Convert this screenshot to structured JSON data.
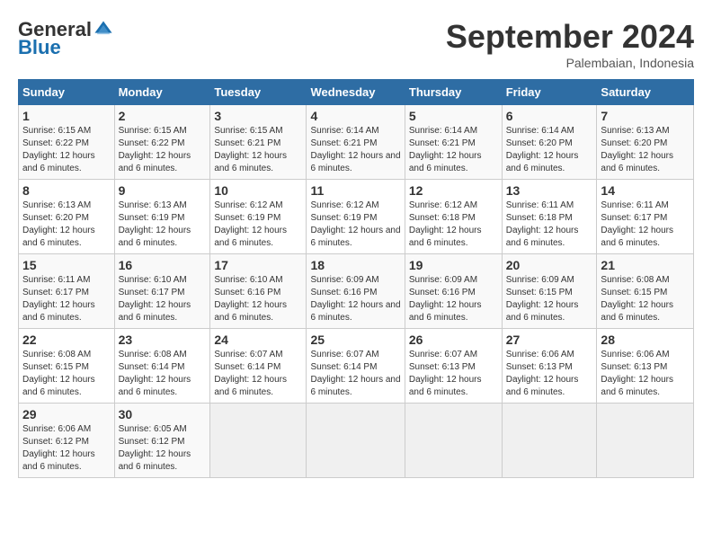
{
  "header": {
    "logo_general": "General",
    "logo_blue": "Blue",
    "month_title": "September 2024",
    "subtitle": "Palembaian, Indonesia"
  },
  "calendar": {
    "days_of_week": [
      "Sunday",
      "Monday",
      "Tuesday",
      "Wednesday",
      "Thursday",
      "Friday",
      "Saturday"
    ],
    "weeks": [
      [
        {
          "day": "",
          "empty": true
        },
        {
          "day": "",
          "empty": true
        },
        {
          "day": "",
          "empty": true
        },
        {
          "day": "",
          "empty": true
        },
        {
          "day": "",
          "empty": true
        },
        {
          "day": "",
          "empty": true
        },
        {
          "day": "",
          "empty": true
        }
      ],
      [
        {
          "num": "1",
          "sunrise": "6:15 AM",
          "sunset": "6:22 PM",
          "daylight": "12 hours and 6 minutes."
        },
        {
          "num": "2",
          "sunrise": "6:15 AM",
          "sunset": "6:22 PM",
          "daylight": "12 hours and 6 minutes."
        },
        {
          "num": "3",
          "sunrise": "6:15 AM",
          "sunset": "6:21 PM",
          "daylight": "12 hours and 6 minutes."
        },
        {
          "num": "4",
          "sunrise": "6:14 AM",
          "sunset": "6:21 PM",
          "daylight": "12 hours and 6 minutes."
        },
        {
          "num": "5",
          "sunrise": "6:14 AM",
          "sunset": "6:21 PM",
          "daylight": "12 hours and 6 minutes."
        },
        {
          "num": "6",
          "sunrise": "6:14 AM",
          "sunset": "6:20 PM",
          "daylight": "12 hours and 6 minutes."
        },
        {
          "num": "7",
          "sunrise": "6:13 AM",
          "sunset": "6:20 PM",
          "daylight": "12 hours and 6 minutes."
        }
      ],
      [
        {
          "num": "8",
          "sunrise": "6:13 AM",
          "sunset": "6:20 PM",
          "daylight": "12 hours and 6 minutes."
        },
        {
          "num": "9",
          "sunrise": "6:13 AM",
          "sunset": "6:19 PM",
          "daylight": "12 hours and 6 minutes."
        },
        {
          "num": "10",
          "sunrise": "6:12 AM",
          "sunset": "6:19 PM",
          "daylight": "12 hours and 6 minutes."
        },
        {
          "num": "11",
          "sunrise": "6:12 AM",
          "sunset": "6:19 PM",
          "daylight": "12 hours and 6 minutes."
        },
        {
          "num": "12",
          "sunrise": "6:12 AM",
          "sunset": "6:18 PM",
          "daylight": "12 hours and 6 minutes."
        },
        {
          "num": "13",
          "sunrise": "6:11 AM",
          "sunset": "6:18 PM",
          "daylight": "12 hours and 6 minutes."
        },
        {
          "num": "14",
          "sunrise": "6:11 AM",
          "sunset": "6:17 PM",
          "daylight": "12 hours and 6 minutes."
        }
      ],
      [
        {
          "num": "15",
          "sunrise": "6:11 AM",
          "sunset": "6:17 PM",
          "daylight": "12 hours and 6 minutes."
        },
        {
          "num": "16",
          "sunrise": "6:10 AM",
          "sunset": "6:17 PM",
          "daylight": "12 hours and 6 minutes."
        },
        {
          "num": "17",
          "sunrise": "6:10 AM",
          "sunset": "6:16 PM",
          "daylight": "12 hours and 6 minutes."
        },
        {
          "num": "18",
          "sunrise": "6:09 AM",
          "sunset": "6:16 PM",
          "daylight": "12 hours and 6 minutes."
        },
        {
          "num": "19",
          "sunrise": "6:09 AM",
          "sunset": "6:16 PM",
          "daylight": "12 hours and 6 minutes."
        },
        {
          "num": "20",
          "sunrise": "6:09 AM",
          "sunset": "6:15 PM",
          "daylight": "12 hours and 6 minutes."
        },
        {
          "num": "21",
          "sunrise": "6:08 AM",
          "sunset": "6:15 PM",
          "daylight": "12 hours and 6 minutes."
        }
      ],
      [
        {
          "num": "22",
          "sunrise": "6:08 AM",
          "sunset": "6:15 PM",
          "daylight": "12 hours and 6 minutes."
        },
        {
          "num": "23",
          "sunrise": "6:08 AM",
          "sunset": "6:14 PM",
          "daylight": "12 hours and 6 minutes."
        },
        {
          "num": "24",
          "sunrise": "6:07 AM",
          "sunset": "6:14 PM",
          "daylight": "12 hours and 6 minutes."
        },
        {
          "num": "25",
          "sunrise": "6:07 AM",
          "sunset": "6:14 PM",
          "daylight": "12 hours and 6 minutes."
        },
        {
          "num": "26",
          "sunrise": "6:07 AM",
          "sunset": "6:13 PM",
          "daylight": "12 hours and 6 minutes."
        },
        {
          "num": "27",
          "sunrise": "6:06 AM",
          "sunset": "6:13 PM",
          "daylight": "12 hours and 6 minutes."
        },
        {
          "num": "28",
          "sunrise": "6:06 AM",
          "sunset": "6:13 PM",
          "daylight": "12 hours and 6 minutes."
        }
      ],
      [
        {
          "num": "29",
          "sunrise": "6:06 AM",
          "sunset": "6:12 PM",
          "daylight": "12 hours and 6 minutes."
        },
        {
          "num": "30",
          "sunrise": "6:05 AM",
          "sunset": "6:12 PM",
          "daylight": "12 hours and 6 minutes."
        },
        {
          "day": "",
          "empty": true
        },
        {
          "day": "",
          "empty": true
        },
        {
          "day": "",
          "empty": true
        },
        {
          "day": "",
          "empty": true
        },
        {
          "day": "",
          "empty": true
        }
      ]
    ]
  }
}
